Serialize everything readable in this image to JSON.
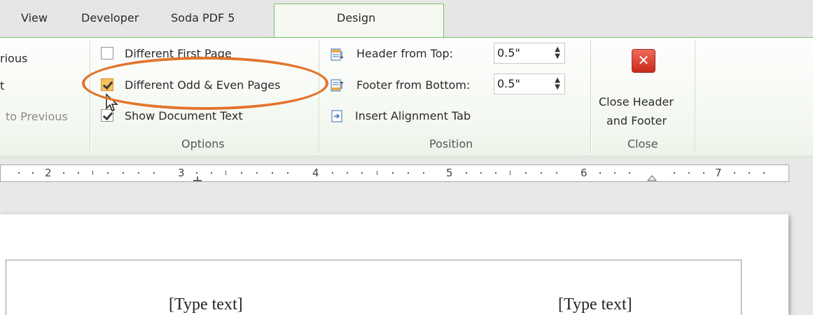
{
  "tabs": [
    {
      "label": "View"
    },
    {
      "label": "Developer"
    },
    {
      "label": "Soda PDF 5"
    },
    {
      "label": "Design"
    }
  ],
  "nav_group": {
    "items": [
      {
        "label": "rious"
      },
      {
        "label": "t"
      },
      {
        "label": "to Previous"
      }
    ]
  },
  "options": {
    "title": "Options",
    "items": [
      {
        "label": "Different First Page",
        "checked": false
      },
      {
        "label": "Different Odd & Even Pages",
        "checked": true
      },
      {
        "label": "Show Document Text",
        "checked": true
      }
    ]
  },
  "position": {
    "title": "Position",
    "header_label": "Header from Top:",
    "header_value": "0.5\"",
    "footer_label": "Footer from Bottom:",
    "footer_value": "0.5\"",
    "insert_tab_label": "Insert Alignment Tab"
  },
  "close_group": {
    "title": "Close",
    "button_line1": "Close Header",
    "button_line2": "and Footer",
    "icon": "close-x-icon"
  },
  "ruler": {
    "numbers": [
      "2",
      "3",
      "4",
      "5",
      "6",
      "7"
    ]
  },
  "document": {
    "left_text": "[Type text]",
    "right_text": "[Type text]"
  },
  "colors": {
    "accent_green": "#7bbf6a",
    "callout_orange": "#e2742c",
    "close_red": "#c8291c"
  }
}
